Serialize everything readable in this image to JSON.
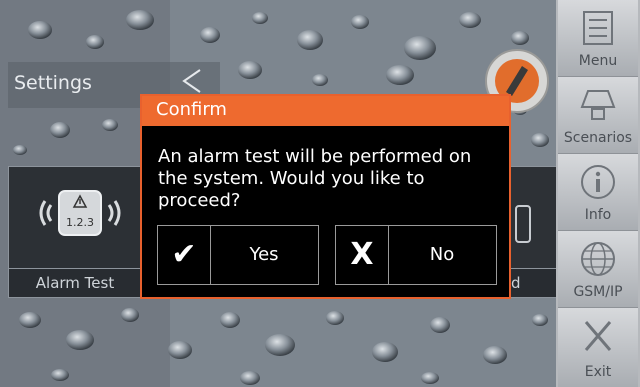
{
  "header": {
    "title": "Settings"
  },
  "tiles": [
    {
      "label": "Alarm Test",
      "icon": "alarm-test-icon",
      "badge": "1.2.3"
    },
    {
      "label": "d",
      "icon": "device-icon"
    }
  ],
  "sidebar": {
    "items": [
      {
        "label": "Menu",
        "icon": "menu-icon"
      },
      {
        "label": "Scenarios",
        "icon": "scenarios-icon"
      },
      {
        "label": "Info",
        "icon": "info-icon"
      },
      {
        "label": "GSM/IP",
        "icon": "globe-icon"
      },
      {
        "label": "Exit",
        "icon": "exit-icon"
      }
    ]
  },
  "dialog": {
    "title": "Confirm",
    "message": "An alarm test will be performed on the system.  Would you like to proceed?",
    "yes": {
      "glyph": "✔",
      "label": "Yes"
    },
    "no": {
      "glyph": "X",
      "label": "No"
    }
  },
  "colors": {
    "accent": "#ee6a2f",
    "dialog_bg": "#000000",
    "sidebar": "#b6b9bd"
  }
}
